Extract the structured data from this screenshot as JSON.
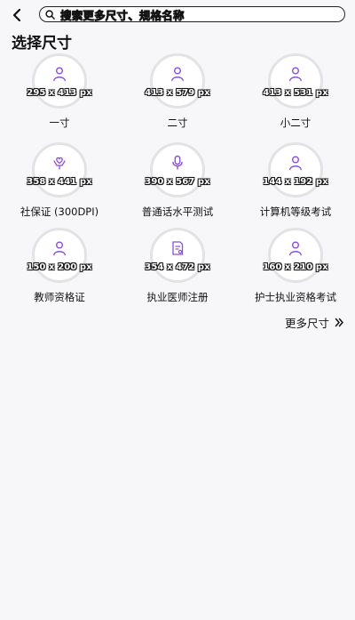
{
  "search": {
    "placeholder": "搜索更多尺寸、规格名称"
  },
  "section_title": "选择尺寸",
  "items": [
    {
      "dims": "295 x 413 px",
      "label": "一寸",
      "icon": "person-icon"
    },
    {
      "dims": "413 x 579 px",
      "label": "二寸",
      "icon": "person-icon"
    },
    {
      "dims": "413 x 531 px",
      "label": "小二寸",
      "icon": "person-icon"
    },
    {
      "dims": "358 x 441 px",
      "label": "社保证 (300DPI)",
      "icon": "heart-hands-icon"
    },
    {
      "dims": "390 x 567 px",
      "label": "普通话水平测试",
      "icon": "microphone-icon"
    },
    {
      "dims": "144 x 192 px",
      "label": "计算机等级考试",
      "icon": "person-icon"
    },
    {
      "dims": "150 x 200 px",
      "label": "教师资格证",
      "icon": "person-icon"
    },
    {
      "dims": "354 x 472 px",
      "label": "执业医师注册",
      "icon": "document-icon"
    },
    {
      "dims": "160 x 210 px",
      "label": "护士执业资格考试",
      "icon": "person-icon"
    }
  ],
  "more_label": "更多尺寸",
  "colors": {
    "accent": "#8a4fd8",
    "ring": "#e3e3e6",
    "background": "#f7f7f9"
  }
}
